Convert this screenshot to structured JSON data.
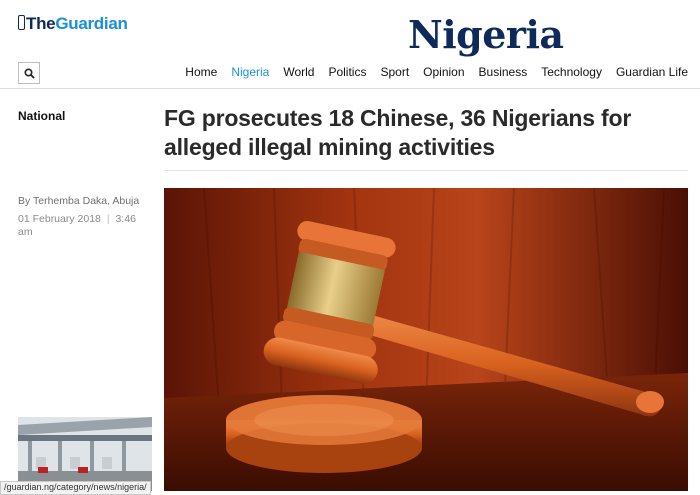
{
  "header": {
    "logo_prefix": "The",
    "logo_name": "Guardian",
    "section_title": "Nigeria"
  },
  "nav": {
    "items": [
      "Home",
      "Nigeria",
      "World",
      "Politics",
      "Sport",
      "Opinion",
      "Business",
      "Technology",
      "Guardian Life"
    ],
    "active": "Nigeria"
  },
  "article": {
    "category": "National",
    "headline": "FG prosecutes 18 Chinese, 36 Nigerians for alleged illegal mining activities",
    "byline_prefix": "By",
    "author": "Terhemba Daka, Abuja",
    "date": "01 February 2018",
    "separator": "|",
    "time": "3:46 am"
  },
  "status_bar": {
    "url": "/guardian.ng/category/news/nigeria/"
  },
  "colors": {
    "accent": "#1b8fd8",
    "section_title": "#0d2a5a"
  }
}
